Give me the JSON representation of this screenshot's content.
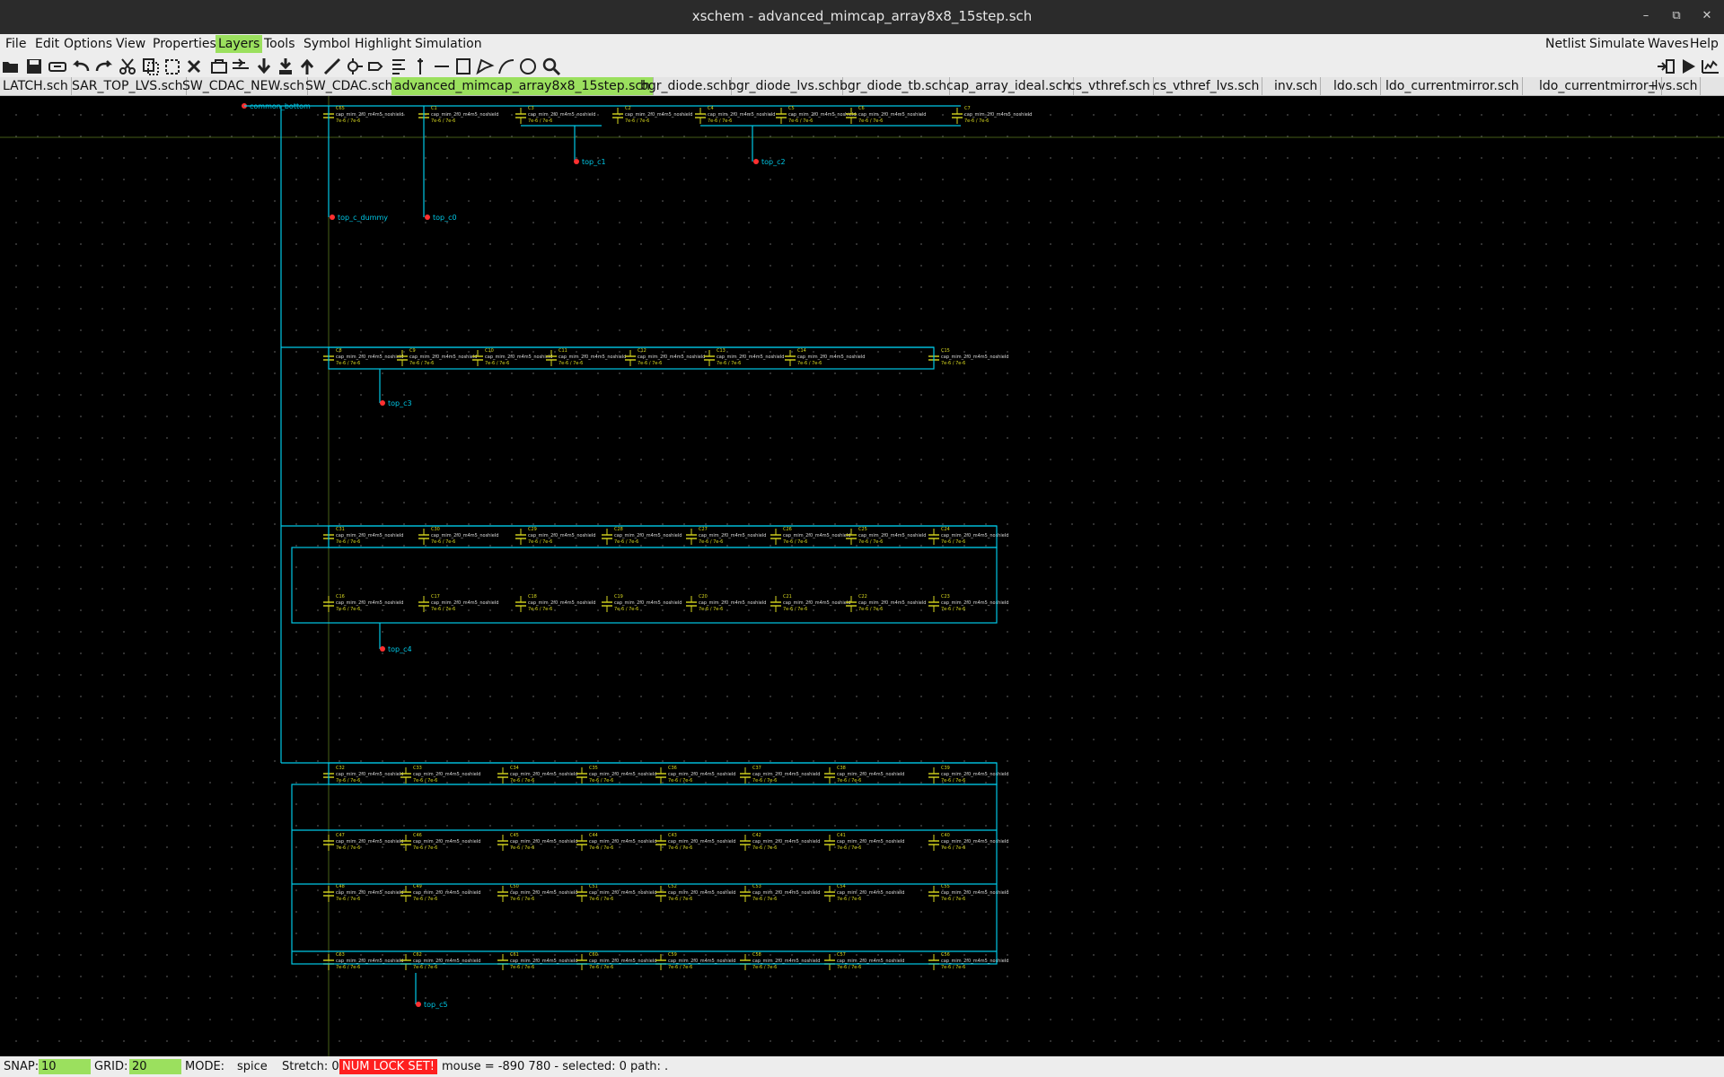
{
  "window": {
    "title": "xschem - advanced_mimcap_array8x8_15step.sch"
  },
  "menu": {
    "left": [
      "File",
      "Edit",
      "Options",
      "View",
      "Properties",
      "Layers",
      "Tools",
      "Symbol",
      "Highlight",
      "Simulation"
    ],
    "active": "Layers",
    "right": [
      "Netlist",
      "Simulate",
      "Waves",
      "Help"
    ]
  },
  "toolbar": {
    "left_icons": [
      "open-icon",
      "save-icon",
      "reload-icon",
      "undo-icon",
      "redo-icon",
      "cut-icon",
      "copy-icon",
      "paste-icon",
      "delete-icon",
      "place-symbol-icon",
      "place-pin-icon",
      "descend-icon",
      "descend-symbol-icon",
      "go-up-icon",
      "wire-icon",
      "net-label-icon",
      "bus-icon",
      "line-icon",
      "rectangle-icon",
      "polygon-icon",
      "arc-icon",
      "circle-icon",
      "zoom-icon",
      "zoom-in-icon",
      "zoom-fit-icon"
    ],
    "right_icons": [
      "netlist-icon",
      "simulate-icon",
      "waves-icon"
    ]
  },
  "tabs": {
    "items": [
      "LATCH.sch",
      "SAR_TOP_LVS.sch",
      "SW_CDAC_NEW.sch",
      "SW_CDAC.sch",
      "advanced_mimcap_array8x8_15step.sch",
      "bgr_diode.sch",
      "bgr_diode_lvs.sch",
      "bgr_diode_tb.sch",
      "cap_array_ideal.sch",
      "cs_vthref.sch",
      "cs_vthref_lvs.sch",
      "inv.sch",
      "ldo.sch",
      "ldo_currentmirror.sch",
      "ldo_currentmirror_lvs.sch",
      "+"
    ],
    "active": "advanced_mimcap_array8x8_15step.sch"
  },
  "schematic": {
    "wire_color": "#00c8e6",
    "component_color": "#d8d820",
    "pin_color": "#ff3030",
    "cap_symbol": "cap_mim_2f0_m4m5_noshield",
    "cap_params": "7e-6 / 7e-6",
    "net_labels": [
      "common_bottom",
      "top_c_dummy",
      "top_c0",
      "top_c1",
      "top_c2",
      "top_c3",
      "top_c4",
      "top_c5"
    ],
    "rows": [
      {
        "refs": [
          "C65",
          "C1",
          "C3",
          "C2",
          "C4",
          "C5",
          "C6",
          "C7"
        ]
      },
      {
        "refs": [
          "C8",
          "C9",
          "C10",
          "C11",
          "C12",
          "C13",
          "C14",
          "C15"
        ]
      },
      {
        "refs": [
          "C31",
          "C30",
          "C29",
          "C28",
          "C27",
          "C26",
          "C25",
          "C24"
        ]
      },
      {
        "refs": [
          "C16",
          "C17",
          "C18",
          "C19",
          "C20",
          "C21",
          "C22",
          "C23"
        ]
      },
      {
        "refs": [
          "C32",
          "C33",
          "C34",
          "C35",
          "C36",
          "C37",
          "C38",
          "C39"
        ]
      },
      {
        "refs": [
          "C47",
          "C46",
          "C45",
          "C44",
          "C43",
          "C42",
          "C41",
          "C40"
        ]
      },
      {
        "refs": [
          "C48",
          "C49",
          "C50",
          "C51",
          "C52",
          "C53",
          "C54",
          "C55"
        ]
      },
      {
        "refs": [
          "C63",
          "C62",
          "C61",
          "C60",
          "C59",
          "C58",
          "C57",
          "C56"
        ]
      }
    ]
  },
  "status": {
    "snap_label": "SNAP:",
    "snap_value": "10",
    "grid_label": "GRID:",
    "grid_value": "20",
    "mode_label": "MODE:",
    "mode_value": "spice",
    "stretch": "Stretch: 0",
    "numlock": "NUM LOCK SET!",
    "info": "mouse = -890 780 - selected: 0 path: ."
  }
}
